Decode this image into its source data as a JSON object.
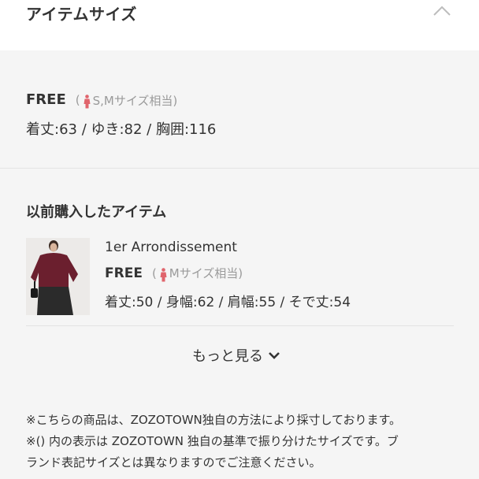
{
  "header": {
    "title": "アイテムサイズ"
  },
  "size": {
    "label": "FREE",
    "equiv_open": "(",
    "equiv_text": "S,Mサイズ相当)",
    "measurements": "着丈:63 / ゆき:82 / 胸囲:116"
  },
  "previous": {
    "title": "以前購入したアイテム",
    "item": {
      "brand": "1er Arrondissement",
      "size": "FREE",
      "equiv_open": "(",
      "equiv_text": "Mサイズ相当)",
      "measurements": "着丈:50 / 身幅:62 / 肩幅:55 / そで丈:54"
    },
    "more_label": "もっと見る"
  },
  "notes": [
    "※こちらの商品は、ZOZOTOWN独自の方法により採寸しております。",
    "※() 内の表示は ZOZOTOWN 独自の基準で振り分けたサイズです。ブ",
    "ランド表記サイズとは異なりますのでご注意ください。"
  ],
  "colors": {
    "person_icon": "#e0646c",
    "sweater": "#6b1f2e",
    "skirt": "#2b2b2b"
  }
}
